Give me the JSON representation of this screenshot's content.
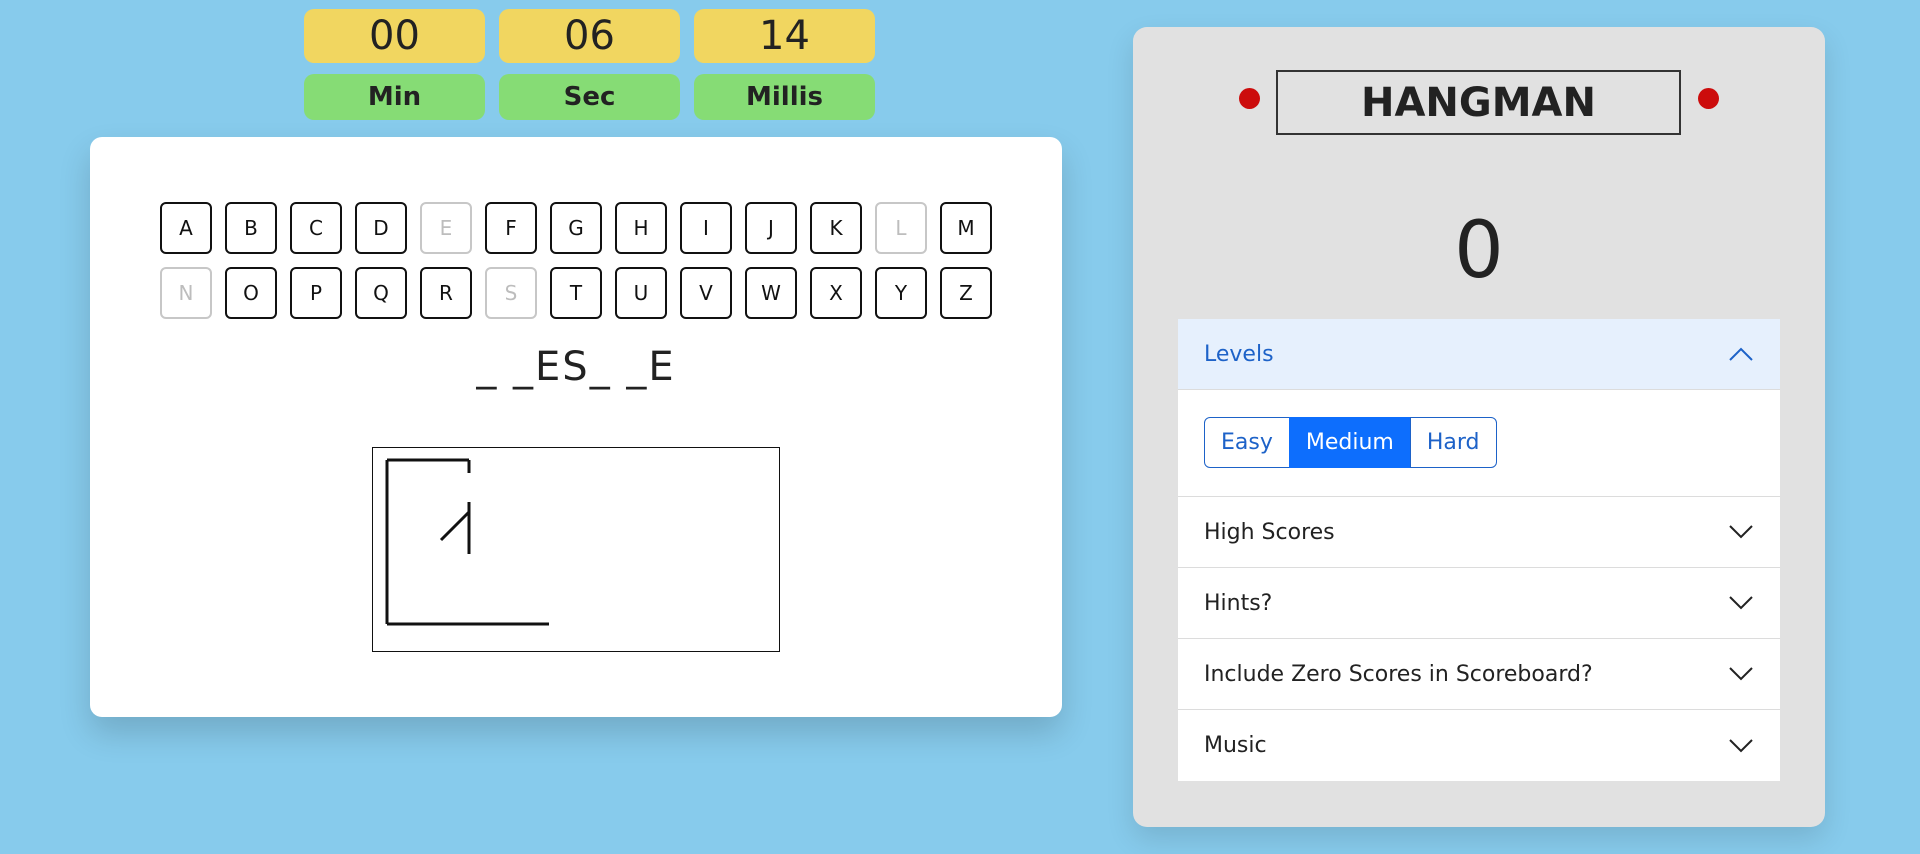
{
  "timer": [
    {
      "value": "00",
      "label": "Min"
    },
    {
      "value": "06",
      "label": "Sec"
    },
    {
      "value": "14",
      "label": "Millis"
    }
  ],
  "keyboard": {
    "keys": [
      "A",
      "B",
      "C",
      "D",
      "E",
      "F",
      "G",
      "H",
      "I",
      "J",
      "K",
      "L",
      "M",
      "N",
      "O",
      "P",
      "Q",
      "R",
      "S",
      "T",
      "U",
      "V",
      "W",
      "X",
      "Y",
      "Z"
    ],
    "used": [
      "E",
      "L",
      "N",
      "S"
    ]
  },
  "word": "_ _ES_ _E",
  "title": "HANGMAN",
  "score": "0",
  "accordion": {
    "levels": {
      "label": "Levels",
      "options": [
        "Easy",
        "Medium",
        "Hard"
      ],
      "selected": "Medium"
    },
    "sections": [
      "High Scores",
      "Hints?",
      "Include Zero Scores in Scoreboard?",
      "Music"
    ]
  },
  "colors": {
    "background": "#87cbec",
    "timer_value": "#f1d660",
    "timer_label": "#86dc75",
    "accent": "#0d6efd",
    "indicator": "#cc0c0c"
  },
  "icons": {
    "expanded": "chevron-up-icon",
    "collapsed": "chevron-down-icon"
  }
}
